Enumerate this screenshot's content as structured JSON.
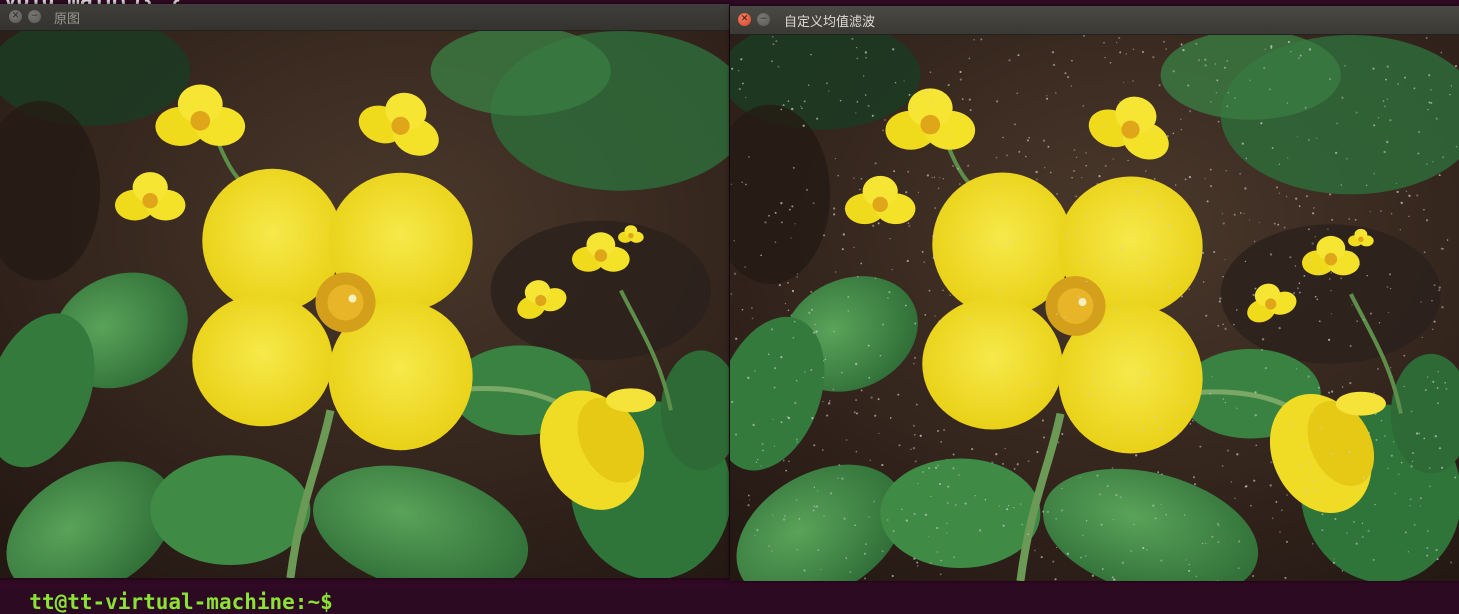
{
  "terminal": {
    "top_line": "void main(){ }",
    "bottom_prompt": "tt@tt-virtual-machine:~$"
  },
  "windows": [
    {
      "title": "原图",
      "active": false,
      "noise": false
    },
    {
      "title": "自定义均值滤波",
      "active": true,
      "noise": true
    }
  ],
  "colors": {
    "terminal_bg": "#300a24",
    "prompt_green": "#8ae234",
    "titlebar": "#3c3b37",
    "title_active_text": "#dfdbd2",
    "title_inactive_text": "#9b9892",
    "close_button": "#e05a3c",
    "petal_yellow": "#f2e12a",
    "leaf_green": "#3f8a45",
    "soil": "#3a2b22"
  },
  "icons": {
    "close": "close-icon",
    "minimize": "minimize-icon"
  }
}
